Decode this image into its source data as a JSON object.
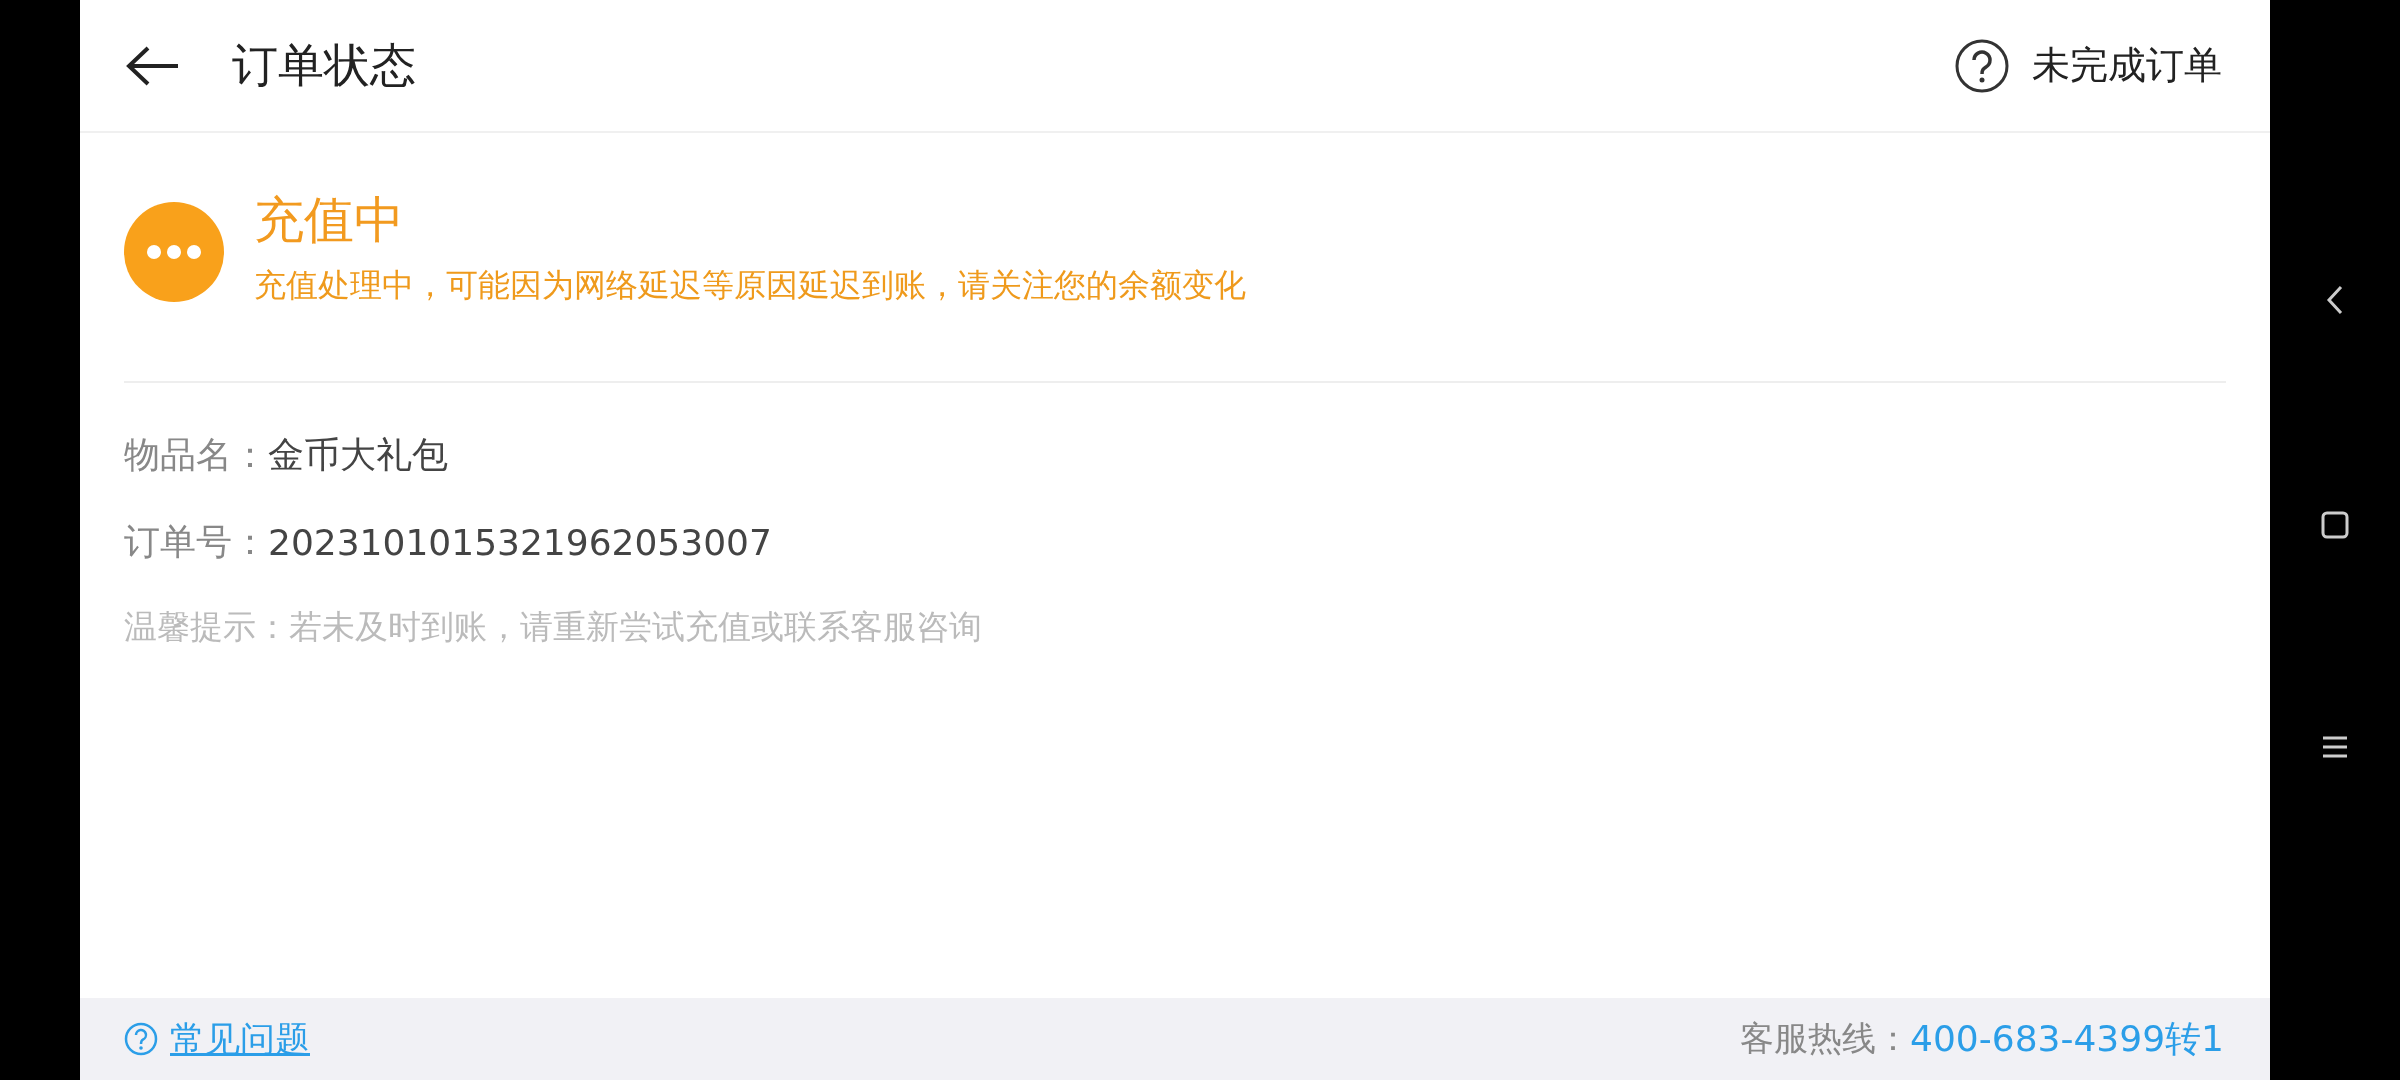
{
  "header": {
    "title": "订单状态",
    "action_label": "未完成订单"
  },
  "status": {
    "title": "充值中",
    "message": "充值处理中，可能因为网络延迟等原因延迟到账，请关注您的余额变化"
  },
  "details": [
    {
      "label": "物品名：",
      "value": "金币大礼包"
    },
    {
      "label": "订单号：",
      "value": "2023101015321962053007"
    }
  ],
  "hint": "温馨提示：若未及时到账，请重新尝试充值或联系客服咨询",
  "footer": {
    "faq_label": "常见问题",
    "hotline_label": "客服热线：",
    "hotline_number": "400-683-4399转1"
  }
}
